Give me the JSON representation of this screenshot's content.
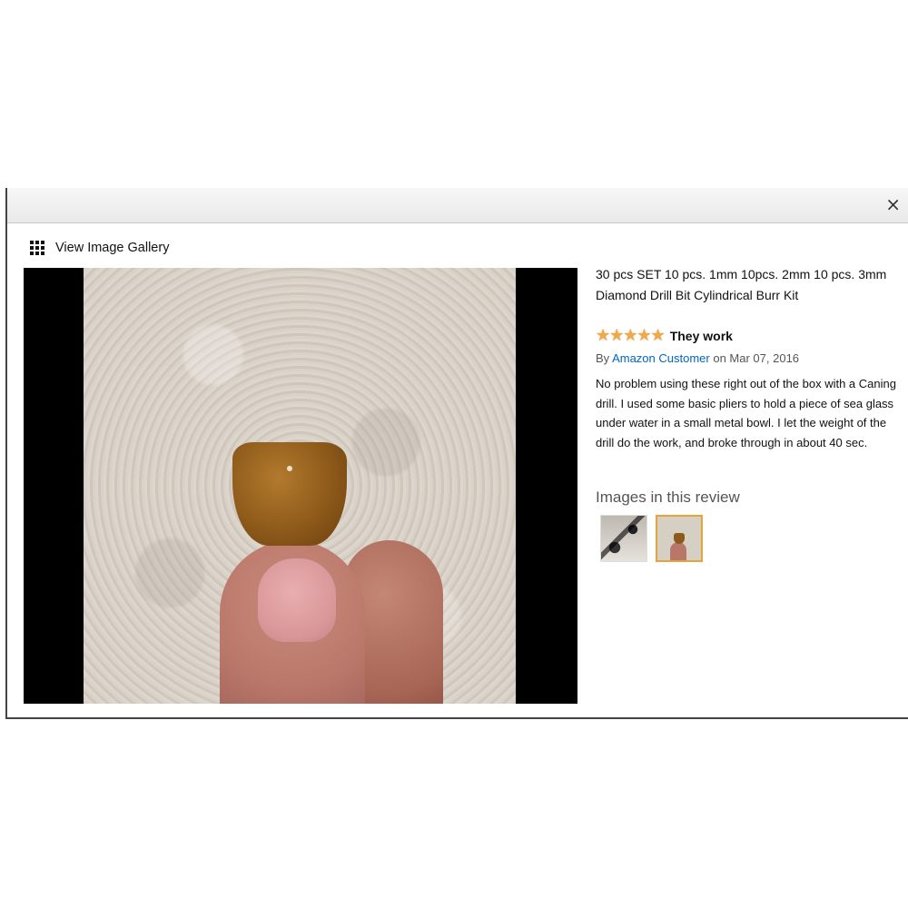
{
  "gallery_link": {
    "label": "View Image Gallery",
    "icon": "grid-icon"
  },
  "close_icon": "×",
  "product": {
    "title": "30 pcs SET 10 pcs. 1mm 10pcs. 2mm 10 pcs. 3mm Diamond Drill Bit Cylindrical Burr Kit"
  },
  "review": {
    "rating": 5,
    "rating_max": 5,
    "stars": "★★★★★",
    "title": "They work",
    "by_label": "By",
    "author": "Amazon Customer",
    "date_label": "on Mar 07, 2016",
    "body": "No problem using these right out of the box with a Caning drill. I used some basic pliers to hold a piece of sea glass under water in a small metal bowl. I let the weight of the drill do the work, and broke through in about 40 sec.",
    "images_heading": "Images in this review",
    "thumbnails": [
      "thumbnail-1",
      "thumbnail-2"
    ],
    "selected_thumbnail": 2
  },
  "colors": {
    "star": "#f3a847",
    "link": "#0066c0",
    "selected_border": "#e4a33b"
  }
}
